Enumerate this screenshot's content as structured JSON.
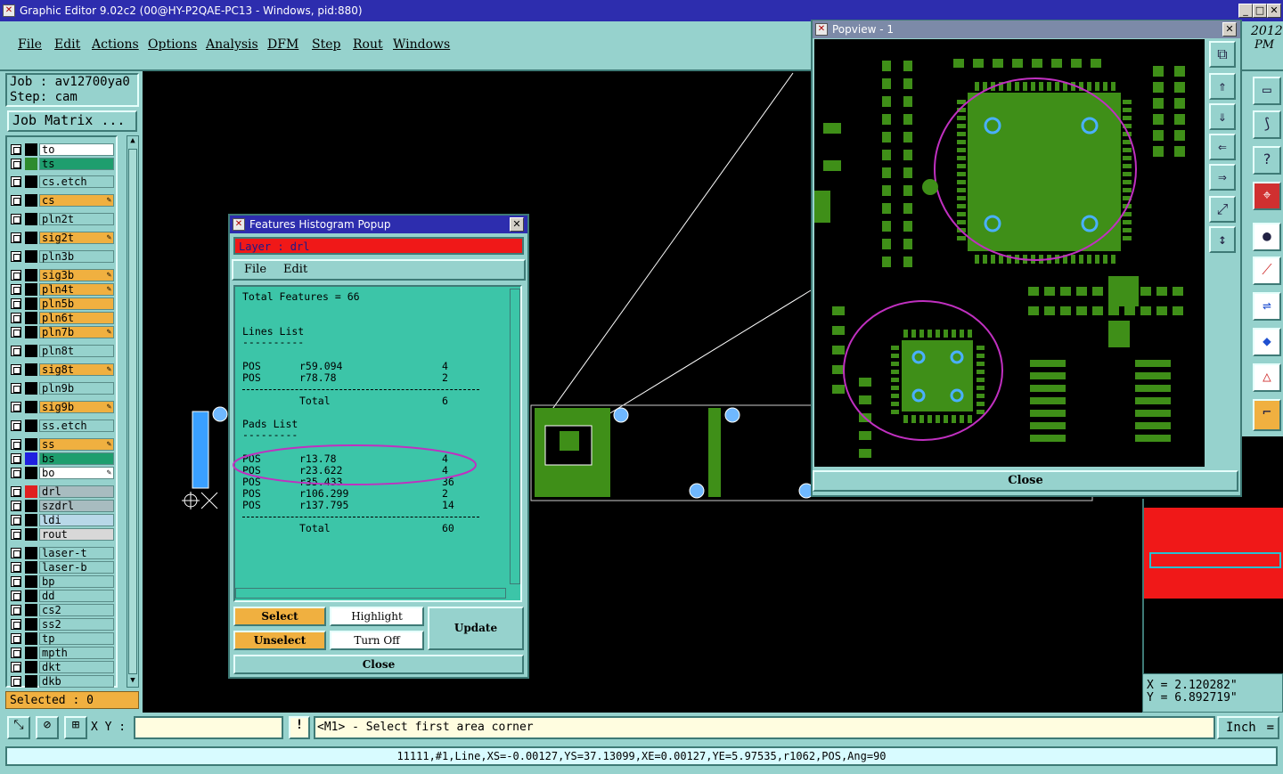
{
  "window": {
    "title": "Graphic Editor 9.02c2 (00@HY-P2QAE-PC13 - Windows, pid:880)"
  },
  "menu": [
    "File",
    "Edit",
    "Actions",
    "Options",
    "Analysis",
    "DFM",
    "Step",
    "Rout",
    "Windows"
  ],
  "job": {
    "job_label": "Job : av12700ya0",
    "step_label": "Step: cam",
    "matrix_button": "Job Matrix ..."
  },
  "layers": [
    {
      "name": "to",
      "color": "#ffffff",
      "swatch": "#000000",
      "pen": false
    },
    {
      "name": "ts",
      "color": "#1e9e6e",
      "swatch": "#2e8b2e",
      "pen": false
    },
    {
      "name": "cs.etch",
      "color": "#96d2cd",
      "swatch": "#000000",
      "pen": false
    },
    {
      "name": "cs",
      "color": "#f0b040",
      "swatch": "#000000",
      "pen": true
    },
    {
      "name": "pln2t",
      "color": "#96d2cd",
      "swatch": "#000000",
      "pen": false
    },
    {
      "name": "sig2t",
      "color": "#f0b040",
      "swatch": "#000000",
      "pen": true
    },
    {
      "name": "pln3b",
      "color": "#96d2cd",
      "swatch": "#000000",
      "pen": false
    },
    {
      "name": "sig3b",
      "color": "#f0b040",
      "swatch": "#000000",
      "pen": true
    },
    {
      "name": "pln4t",
      "color": "#f0b040",
      "swatch": "#000000",
      "pen": true
    },
    {
      "name": "pln5b",
      "color": "#f0b040",
      "swatch": "#000000",
      "pen": false
    },
    {
      "name": "pln6t",
      "color": "#f0b040",
      "swatch": "#000000",
      "pen": false
    },
    {
      "name": "pln7b",
      "color": "#f0b040",
      "swatch": "#000000",
      "pen": true
    },
    {
      "name": "pln8t",
      "color": "#96d2cd",
      "swatch": "#000000",
      "pen": false
    },
    {
      "name": "sig8t",
      "color": "#f0b040",
      "swatch": "#000000",
      "pen": true
    },
    {
      "name": "pln9b",
      "color": "#96d2cd",
      "swatch": "#000000",
      "pen": false
    },
    {
      "name": "sig9b",
      "color": "#f0b040",
      "swatch": "#000000",
      "pen": true
    },
    {
      "name": "ss.etch",
      "color": "#96d2cd",
      "swatch": "#000000",
      "pen": false
    },
    {
      "name": "ss",
      "color": "#f0b040",
      "swatch": "#000000",
      "pen": true
    },
    {
      "name": "bs",
      "color": "#1e9e6e",
      "swatch": "#2020e0",
      "pen": false
    },
    {
      "name": "bo",
      "color": "#ffffff",
      "swatch": "#000000",
      "pen": true
    },
    {
      "name": "drl",
      "color": "#a8bcc0",
      "swatch": "#e02020",
      "pen": false
    },
    {
      "name": "szdrl",
      "color": "#a8bcc0",
      "swatch": "#000000",
      "pen": false
    },
    {
      "name": "ldi",
      "color": "#b8d8e8",
      "swatch": "#000000",
      "pen": false
    },
    {
      "name": "rout",
      "color": "#d8d8d8",
      "swatch": "#000000",
      "pen": false
    },
    {
      "name": "laser-t",
      "color": "#96d2cd",
      "swatch": "#000000",
      "pen": false
    },
    {
      "name": "laser-b",
      "color": "#96d2cd",
      "swatch": "#000000",
      "pen": false
    },
    {
      "name": "bp",
      "color": "#96d2cd",
      "swatch": "#000000",
      "pen": false
    },
    {
      "name": "dd",
      "color": "#96d2cd",
      "swatch": "#000000",
      "pen": false
    },
    {
      "name": "cs2",
      "color": "#96d2cd",
      "swatch": "#000000",
      "pen": false
    },
    {
      "name": "ss2",
      "color": "#96d2cd",
      "swatch": "#000000",
      "pen": false
    },
    {
      "name": "tp",
      "color": "#96d2cd",
      "swatch": "#000000",
      "pen": false
    },
    {
      "name": "mpth",
      "color": "#96d2cd",
      "swatch": "#000000",
      "pen": false
    },
    {
      "name": "dkt",
      "color": "#96d2cd",
      "swatch": "#000000",
      "pen": false
    },
    {
      "name": "dkb",
      "color": "#96d2cd",
      "swatch": "#000000",
      "pen": false
    }
  ],
  "selected": "Selected : 0",
  "histogram": {
    "title": "Features Histogram Popup",
    "layer_label": "Layer :  drl",
    "menu": [
      "File",
      "Edit"
    ],
    "total_features": "Total Features = 66",
    "lines_title": "Lines List",
    "lines": [
      {
        "pol": "POS",
        "sym": "r59.094",
        "count": "4"
      },
      {
        "pol": "POS",
        "sym": "r78.78",
        "count": "2"
      }
    ],
    "lines_total": "6",
    "pads_title": "Pads List",
    "pads": [
      {
        "pol": "POS",
        "sym": "r13.78",
        "count": "4"
      },
      {
        "pol": "POS",
        "sym": "r23.622",
        "count": "4"
      },
      {
        "pol": "POS",
        "sym": "r35.433",
        "count": "36"
      },
      {
        "pol": "POS",
        "sym": "r106.299",
        "count": "2"
      },
      {
        "pol": "POS",
        "sym": "r137.795",
        "count": "14"
      }
    ],
    "pads_total": "60",
    "total_label": "Total",
    "buttons": {
      "select": "Select",
      "unselect": "Unselect",
      "highlight": "Highlight",
      "turn_off": "Turn Off",
      "update": "Update",
      "close": "Close"
    }
  },
  "popview": {
    "title": "Popview - 1",
    "close": "Close"
  },
  "corner_text": {
    "year": "2012",
    "pm": "PM"
  },
  "coords": {
    "x": "X = 2.120282\"",
    "y": "Y = 6.892719\""
  },
  "status": {
    "xy_label": "X Y :",
    "prompt": "<M1> - Select first area corner",
    "units": "Inch"
  },
  "feature_info": "11111,#1,Line,XS=-0.00127,YS=37.13099,XE=0.00127,YE=5.97535,r1062,POS,Ang=90"
}
